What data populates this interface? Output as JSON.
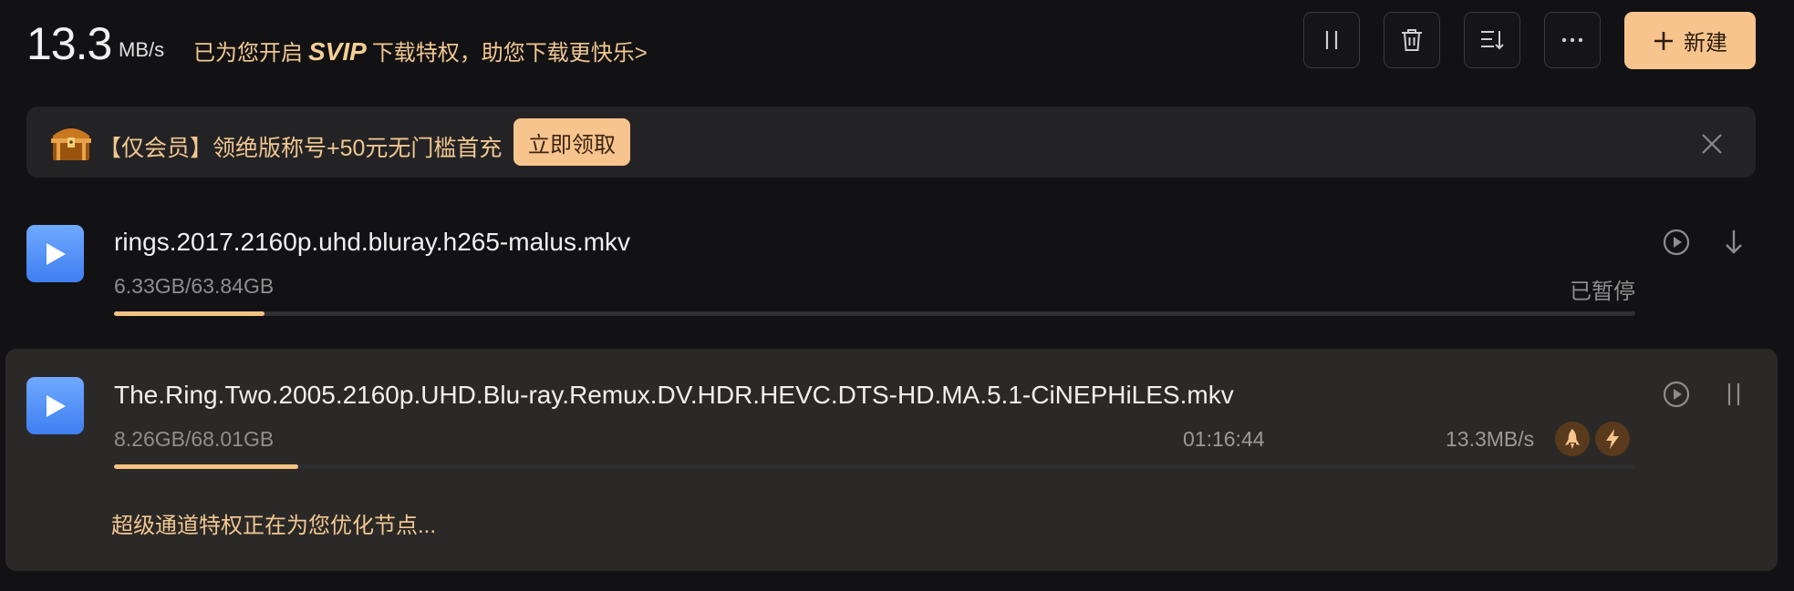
{
  "header": {
    "speed_value": "13.3",
    "speed_unit": "MB/s",
    "promo_prefix": "已为您开启",
    "promo_svip": "SVIP",
    "promo_suffix": "下载特权，助您下载更快乐>",
    "new_label": "新建"
  },
  "toolbar_icons": [
    "pause-all-icon",
    "delete-icon",
    "sort-icon",
    "more-icon",
    "plus-icon"
  ],
  "banner": {
    "text": "【仅会员】领绝版称号+50元无门槛首充",
    "claim_label": "立即领取"
  },
  "downloads": [
    {
      "filename": "rings.2017.2160p.uhd.bluray.h265-malus.mkv",
      "size": "6.33GB/63.84GB",
      "status": "已暂停",
      "progress": 0.099
    },
    {
      "filename": "The.Ring.Two.2005.2160p.UHD.Blu-ray.Remux.DV.HDR.HEVC.DTS-HD.MA.5.1-CiNEPHiLES.mkv",
      "size": "8.26GB/68.01GB",
      "remaining": "01:16:44",
      "speed": "13.3MB/s",
      "progress": 0.121,
      "optimizing": "超级通道特权正在为您优化节点..."
    }
  ],
  "colors": {
    "background": "#121214",
    "accent": "#f8c48d",
    "gold_text": "#f2c790",
    "file_icon": "#4f8ff7"
  }
}
